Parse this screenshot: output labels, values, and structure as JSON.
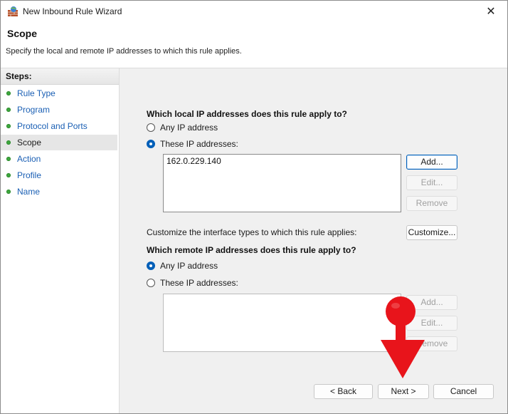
{
  "window": {
    "title": "New Inbound Rule Wizard",
    "close_glyph": "✕"
  },
  "header": {
    "title": "Scope",
    "description": "Specify the local and remote IP addresses to which this rule applies."
  },
  "steps": {
    "heading": "Steps:",
    "items": [
      {
        "label": "Rule Type",
        "active": false
      },
      {
        "label": "Program",
        "active": false
      },
      {
        "label": "Protocol and Ports",
        "active": false
      },
      {
        "label": "Scope",
        "active": true
      },
      {
        "label": "Action",
        "active": false
      },
      {
        "label": "Profile",
        "active": false
      },
      {
        "label": "Name",
        "active": false
      }
    ]
  },
  "local": {
    "question": "Which local IP addresses does this rule apply to?",
    "any_label": "Any IP address",
    "these_label": "These IP addresses:",
    "selected": "these",
    "addresses": [
      "162.0.229.140"
    ],
    "add_label": "Add...",
    "edit_label": "Edit...",
    "remove_label": "Remove"
  },
  "interface": {
    "text": "Customize the interface types to which this rule applies:",
    "button_label": "Customize..."
  },
  "remote": {
    "question": "Which remote IP addresses does this rule apply to?",
    "any_label": "Any IP address",
    "these_label": "These IP addresses:",
    "selected": "any",
    "addresses": [],
    "add_label": "Add...",
    "edit_label": "Edit...",
    "remove_label": "Remove"
  },
  "footer": {
    "back_label": "< Back",
    "next_label": "Next >",
    "cancel_label": "Cancel"
  },
  "colors": {
    "accent": "#005fb8",
    "step_dot": "#3fa83f",
    "annotation": "#e8141b",
    "content_bg": "#f0f0f0"
  }
}
